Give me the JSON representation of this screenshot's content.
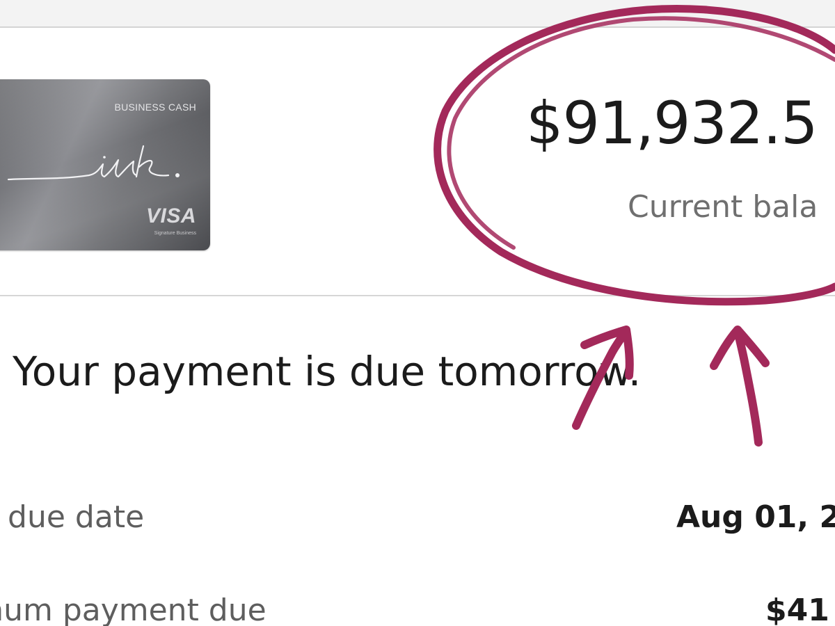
{
  "colors": {
    "annotation_ink": "#a3295a",
    "card_metal": "#6d6e72",
    "divider": "#d6d6d6",
    "muted_text": "#6f6f6f"
  },
  "card": {
    "product_name": "BUSINESS CASH",
    "brand_script": "ink.",
    "network": "VISA",
    "tier": "Signature Business"
  },
  "balance": {
    "amount": "$91,932.5",
    "label": "Current bala"
  },
  "notice": {
    "message": "Your payment is due tomorrow."
  },
  "details": {
    "rows": [
      {
        "label": "ment due date",
        "value": "Aug 01, 2"
      },
      {
        "label": "imum payment due",
        "value": "$41"
      }
    ]
  },
  "annotation": {
    "shape": "hand-drawn circle around balance with two upward arrows"
  }
}
